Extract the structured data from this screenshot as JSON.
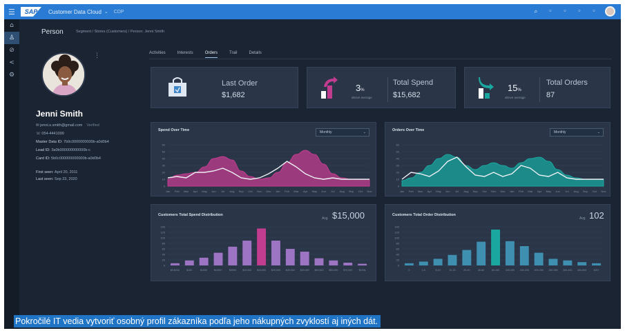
{
  "shell": {
    "app_title": "Customer Data Cloud",
    "app_caret": "⌄",
    "env": "CDP",
    "menu_icon": "menu-icon",
    "right_icons": [
      "search-icon",
      "bell-icon",
      "help-icon",
      "apps-icon",
      "settings-icon"
    ]
  },
  "rail": {
    "icons": [
      "home-icon",
      "person-icon",
      "tag-icon",
      "share-icon",
      "gear-icon"
    ],
    "active_index": 1
  },
  "page": {
    "title": "Person",
    "breadcrumb": "Segment / Stores (Customers) / Person: Jenni Smith"
  },
  "profile": {
    "name": "Jenni Smith",
    "email": "jenni.s.smith@gmail.com",
    "email_tag": "Verified",
    "phone": "054-4441099",
    "master_data_label": "Master Data ID:",
    "master_data_id": "7b9c0000000000b-a0d0b4",
    "lead_label": "Lead ID:",
    "lead_id": "3a0b000000000000b-c",
    "card_label": "Card ID:",
    "card_id": "5b0c000000000000b-a0d0b4",
    "first_seen_label": "First seen:",
    "first_seen": "April 20, 2011",
    "last_seen_label": "Last seen:",
    "last_seen": "Sep 23, 2020"
  },
  "tabs": [
    "Activities",
    "Interests",
    "Orders",
    "Trail",
    "Details"
  ],
  "active_tab": 2,
  "kpis": [
    {
      "label": "Last Order",
      "value": "$1,682"
    },
    {
      "label": "Total Spend",
      "value": "$15,682",
      "pct": "3",
      "pct_unit": "%",
      "sub": "above average"
    },
    {
      "label": "Total Orders",
      "value": "87",
      "pct": "15",
      "pct_unit": "%",
      "sub": "above average"
    }
  ],
  "colors": {
    "magenta": "#c23c8f",
    "teal": "#1aa7a0",
    "purple": "#9d73c4",
    "accent": "#2a7bd3"
  },
  "dropdown_value": "Monthly",
  "charts": {
    "spend_title": "Spend Over Time",
    "orders_title": "Orders Over Time",
    "dist_spend_title": "Customers Total Spend Distribution",
    "dist_orders_title": "Customers Total Order Distribution",
    "avg_label": "Avg",
    "avg_spend": "$15,000",
    "avg_orders": "102"
  },
  "chart_data": [
    {
      "type": "area",
      "title": "Spend Over Time",
      "x": [
        "Jan",
        "Feb",
        "Mar",
        "Apr",
        "May",
        "Jun",
        "Jul",
        "Aug",
        "Sep",
        "Oct",
        "Nov",
        "Dec",
        "Jan",
        "Feb",
        "Mar",
        "Apr",
        "May",
        "Jun",
        "Jul",
        "Aug",
        "Sep",
        "Oct",
        "Nov"
      ],
      "ylim": [
        0,
        60
      ],
      "series": [
        {
          "values": [
            10,
            16,
            18,
            20,
            28,
            40,
            43,
            38,
            22,
            14,
            10,
            12,
            20,
            34,
            46,
            52,
            46,
            32,
            18,
            12,
            10,
            10,
            10
          ]
        },
        {
          "values": [
            12,
            14,
            12,
            20,
            20,
            22,
            26,
            20,
            12,
            10,
            12,
            18,
            26,
            36,
            28,
            18,
            12,
            10,
            12,
            10,
            10,
            10,
            10
          ]
        }
      ]
    },
    {
      "type": "area",
      "title": "Orders Over Time",
      "x": [
        "Jan",
        "Feb",
        "Mar",
        "Apr",
        "May",
        "Jun",
        "Jul",
        "Aug",
        "Sep",
        "Oct",
        "Nov",
        "Dec",
        "Jan",
        "Feb",
        "Mar",
        "Apr",
        "May",
        "Jun",
        "Jul",
        "Aug",
        "Sep",
        "Oct",
        "Nov"
      ],
      "ylim": [
        0,
        60
      ],
      "series": [
        {
          "values": [
            8,
            12,
            20,
            30,
            40,
            46,
            42,
            30,
            24,
            30,
            34,
            30,
            26,
            34,
            40,
            42,
            36,
            24,
            16,
            12,
            10,
            10,
            10
          ]
        },
        {
          "values": [
            10,
            20,
            18,
            14,
            22,
            36,
            42,
            28,
            16,
            14,
            20,
            14,
            18,
            30,
            26,
            16,
            14,
            20,
            12,
            10,
            10,
            10,
            10
          ]
        }
      ]
    },
    {
      "type": "bar",
      "title": "Customers Total Spend Distribution",
      "categories": [
        "$0-$100",
        "$100",
        "$1000",
        "$1000+",
        "$5000",
        "$10,000",
        "$15,000",
        "$20,000",
        "$25,000",
        "$30,000",
        "$40,000",
        "$50,000",
        "$70,000",
        "$100k"
      ],
      "values": [
        8,
        18,
        28,
        46,
        68,
        90,
        134,
        90,
        60,
        50,
        26,
        18,
        10,
        6
      ],
      "highlight_index": 6,
      "ylim": [
        0,
        140
      ]
    },
    {
      "type": "bar",
      "title": "Customers Total Order Distribution",
      "categories": [
        "0",
        "1-5",
        "5-10",
        "10-20",
        "20-40",
        "40-60",
        "60-100",
        "100-150",
        "150-200",
        "200-250",
        "250-300",
        "300-400",
        "400-500",
        "500+"
      ],
      "values": [
        8,
        14,
        24,
        38,
        56,
        86,
        130,
        88,
        70,
        46,
        24,
        18,
        12,
        8
      ],
      "highlight_index": 6,
      "ylim": [
        0,
        140
      ]
    }
  ],
  "caption": "Pokročilé IT vedia vytvoriť osobný profil zákazníka podľa jeho nákupných zvyklostí aj iných dát."
}
